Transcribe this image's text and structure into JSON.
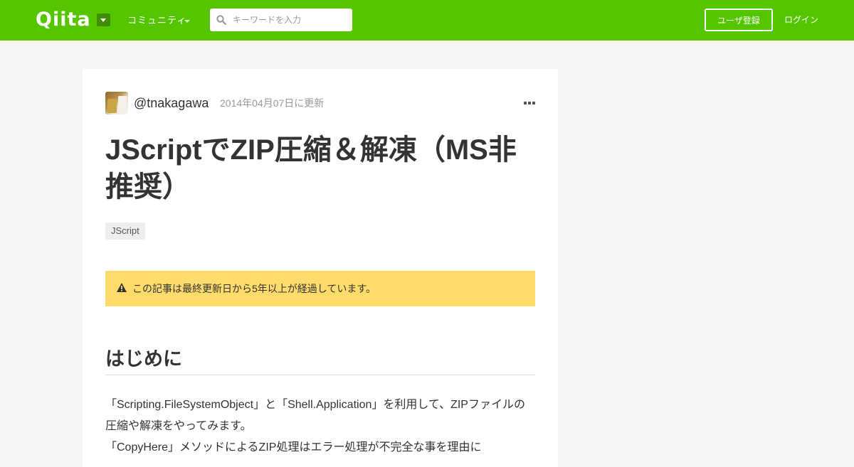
{
  "header": {
    "logo": "Qiita",
    "community_label": "コミュニティ",
    "search_placeholder": "キーワードを入力",
    "signup_label": "ユーザ登録",
    "login_label": "ログイン",
    "brand_color": "#55c500"
  },
  "article": {
    "author": "@tnakagawa",
    "updated": "2014年04月07日に更新",
    "title": "JScriptでZIP圧縮＆解凍（MS非推奨）",
    "tags": [
      "JScript"
    ],
    "notice": "この記事は最終更新日から5年以上が経過しています。",
    "section_heading": "はじめに",
    "body_lines": [
      "「Scripting.FileSystemObject」と「Shell.Application」を利用して、ZIPファイルの",
      "圧縮や解凍をやってみます。",
      "「CopyHere」メソッドによるZIP処理はエラー処理が不完全な事を理由に"
    ]
  },
  "icons": {
    "search": "search-icon",
    "more": "more-icon",
    "warning": "warning-icon"
  }
}
